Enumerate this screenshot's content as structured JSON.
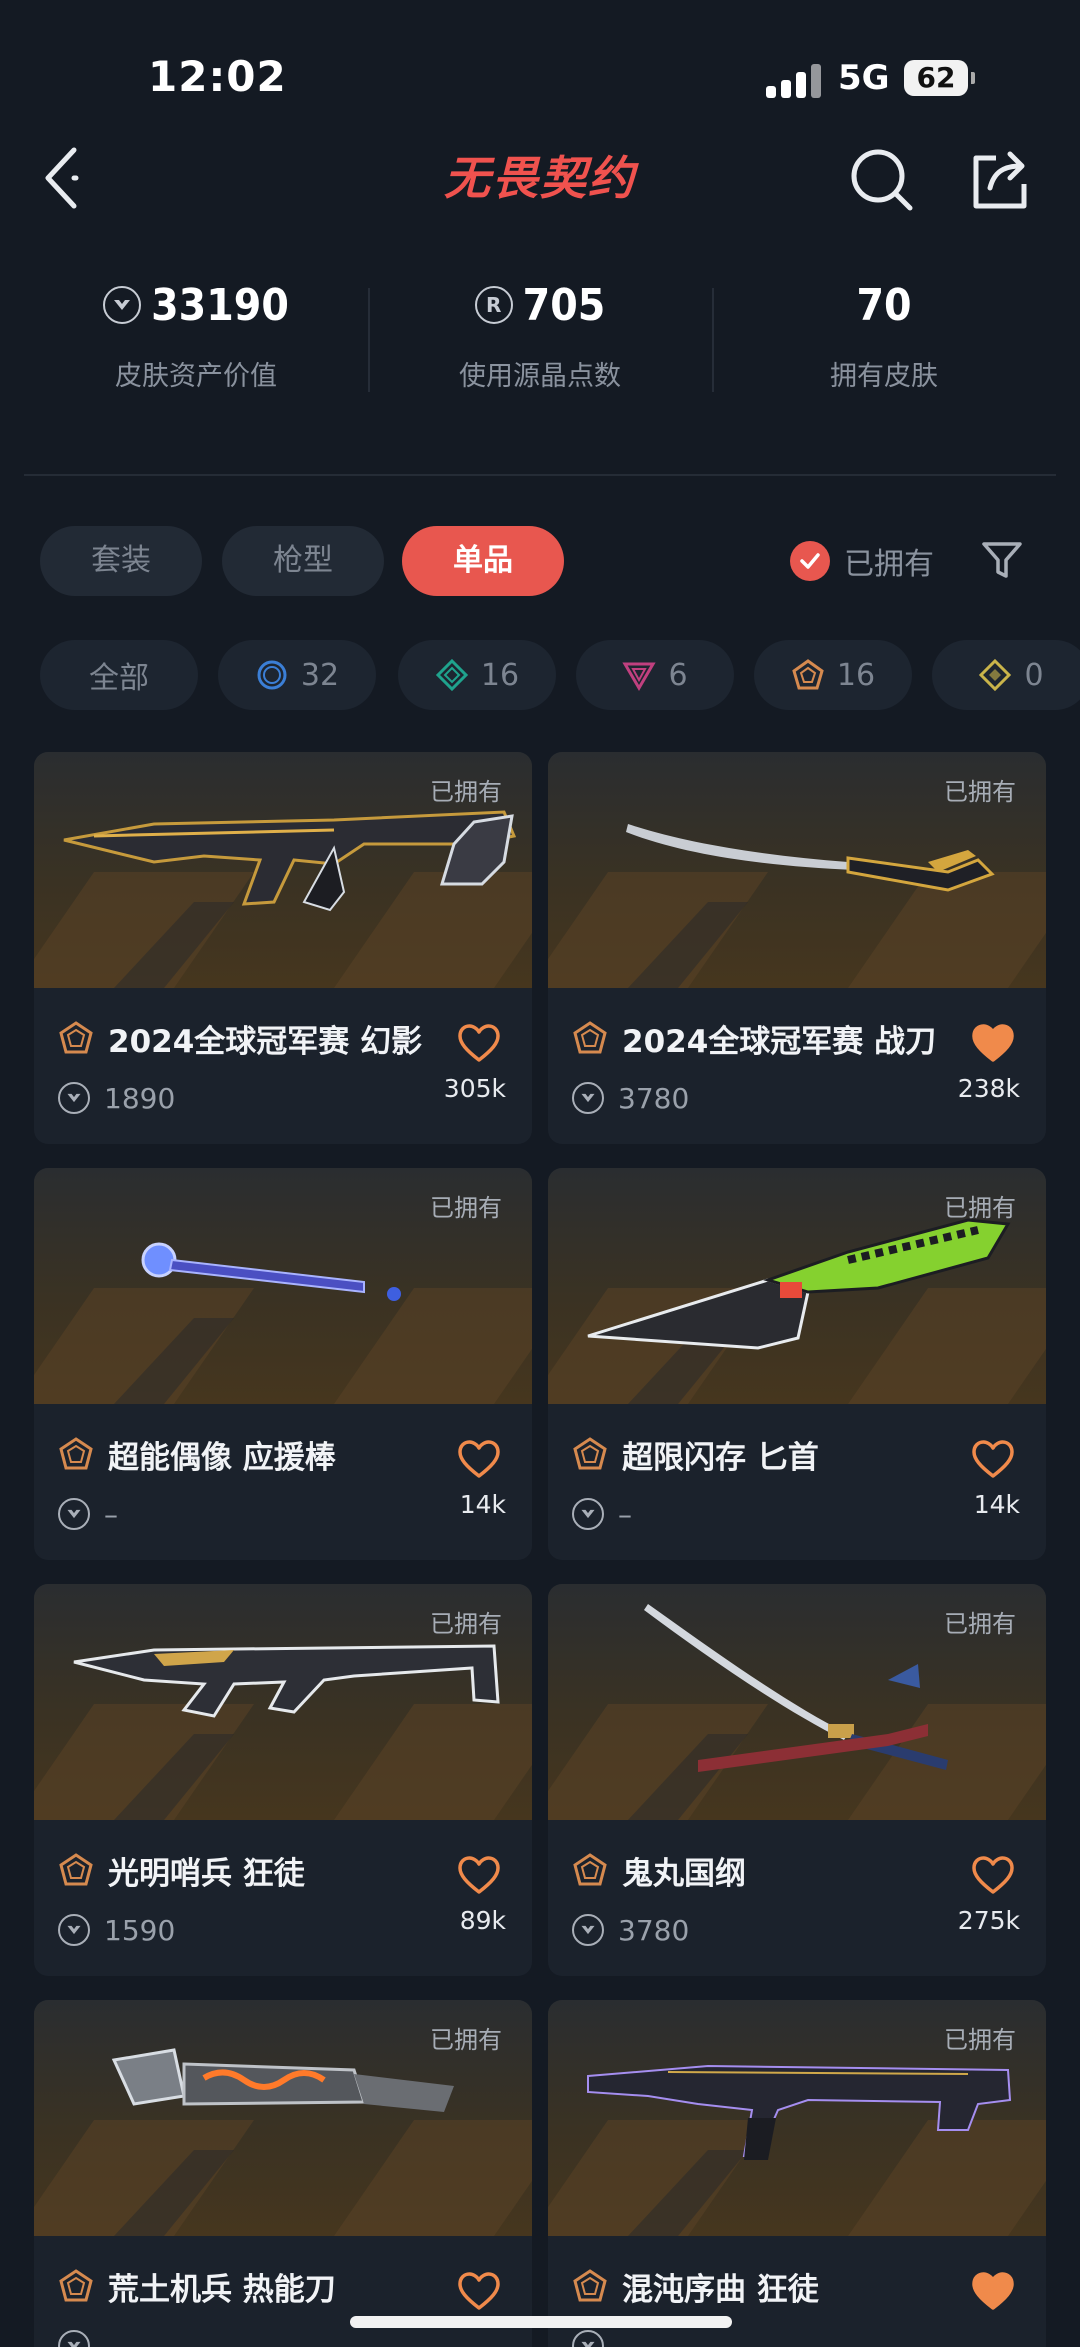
{
  "status": {
    "time": "12:02",
    "network": "5G",
    "battery": "62"
  },
  "header": {
    "title": "无畏契约"
  },
  "stats": [
    {
      "value": "33190",
      "label": "皮肤资产价值",
      "icon": "vp-coin-icon"
    },
    {
      "value": "705",
      "label": "使用源晶点数",
      "icon": "radianite-icon"
    },
    {
      "value": "70",
      "label": "拥有皮肤",
      "icon": ""
    }
  ],
  "tabs": [
    {
      "label": "套装",
      "active": false
    },
    {
      "label": "枪型",
      "active": false
    },
    {
      "label": "单品",
      "active": true
    }
  ],
  "owned_filter": {
    "label": "已拥有",
    "checked": true
  },
  "rarity_chips": [
    {
      "label": "全部",
      "icon": ""
    },
    {
      "label": "32",
      "icon": "select-tier-icon",
      "color": "#3b7fd6"
    },
    {
      "label": "16",
      "icon": "deluxe-tier-icon",
      "color": "#1fa38d"
    },
    {
      "label": "6",
      "icon": "premium-tier-icon",
      "color": "#c0407f"
    },
    {
      "label": "16",
      "icon": "exclusive-tier-icon",
      "color": "#d68a4f"
    },
    {
      "label": "0",
      "icon": "ultra-tier-icon",
      "color": "#c9b44a"
    }
  ],
  "cards": [
    {
      "owned": "已拥有",
      "name": "2024全球冠军赛 幻影",
      "price": "1890",
      "favorites": "305k",
      "favorited": false
    },
    {
      "owned": "已拥有",
      "name": "2024全球冠军赛 战刀",
      "price": "3780",
      "favorites": "238k",
      "favorited": true
    },
    {
      "owned": "已拥有",
      "name": "超能偶像 应援棒",
      "price": "–",
      "favorites": "14k",
      "favorited": false
    },
    {
      "owned": "已拥有",
      "name": "超限闪存 匕首",
      "price": "–",
      "favorites": "14k",
      "favorited": false
    },
    {
      "owned": "已拥有",
      "name": "光明哨兵 狂徒",
      "price": "1590",
      "favorites": "89k",
      "favorited": false
    },
    {
      "owned": "已拥有",
      "name": "鬼丸国纲",
      "price": "3780",
      "favorites": "275k",
      "favorited": false
    },
    {
      "owned": "已拥有",
      "name": "荒土机兵 热能刀",
      "price": "",
      "favorites": "",
      "favorited": false
    },
    {
      "owned": "已拥有",
      "name": "混沌序曲 狂徒",
      "price": "",
      "favorites": "",
      "favorited": true
    }
  ],
  "colors": {
    "accent": "#e8574f",
    "background": "#141a23",
    "card": "#1b222c",
    "heart": "#f08a4b"
  }
}
